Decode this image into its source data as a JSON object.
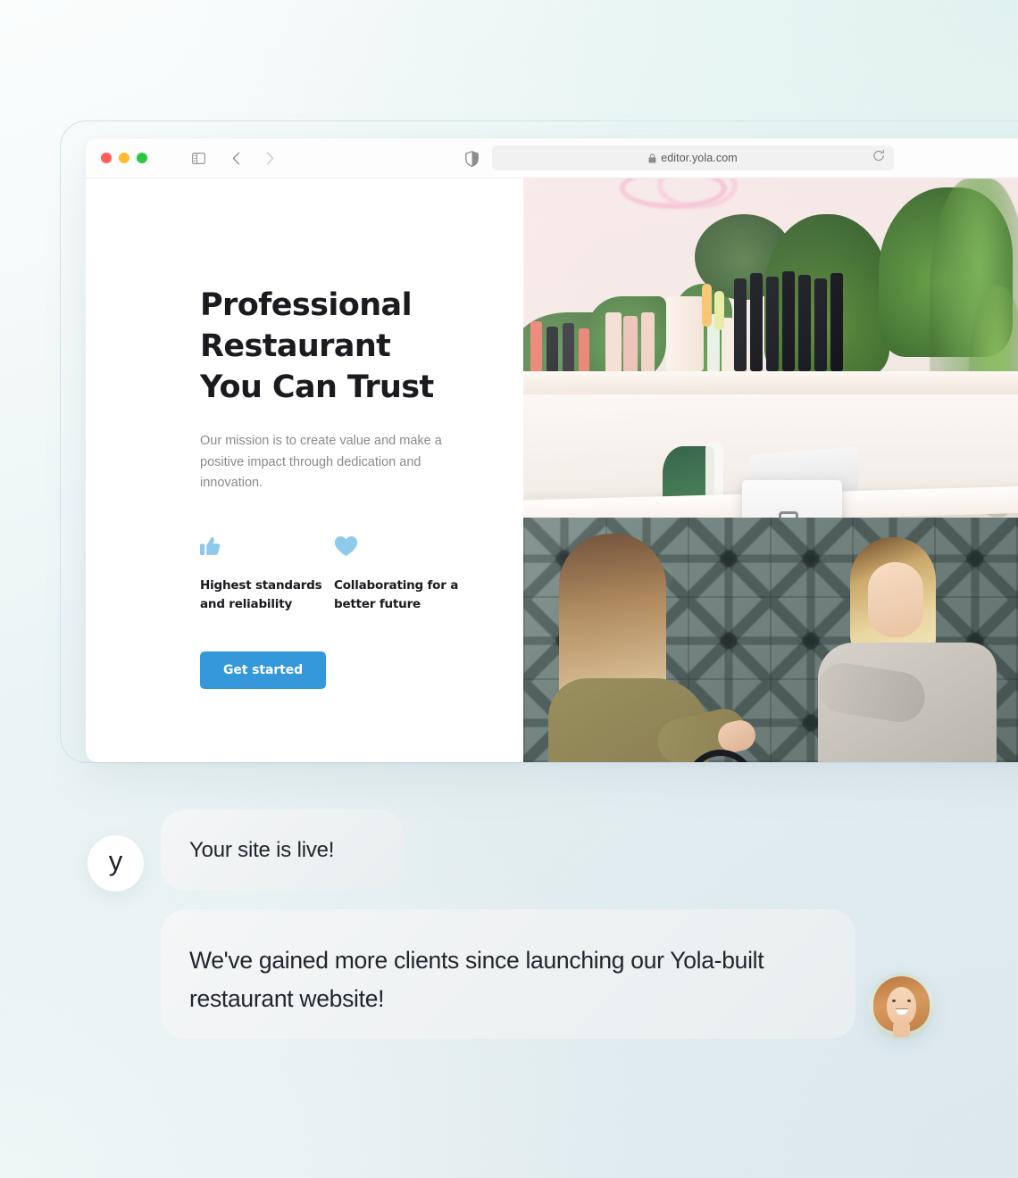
{
  "browser": {
    "traffic_lights": [
      "close",
      "minimize",
      "maximize"
    ],
    "sidebar_icon": "sidebar-toggle-icon",
    "back_icon": "chevron-left-icon",
    "forward_icon": "chevron-right-icon",
    "shield_icon": "shield-icon",
    "lock_icon": "lock-icon",
    "url": "editor.yola.com",
    "reload_icon": "reload-icon"
  },
  "hero": {
    "headline": "Professional Restaurant You Can Trust",
    "subtext": "Our mission is to create value and make a positive impact through dedication and innovation.",
    "features": [
      {
        "icon": "thumbs-up-icon",
        "label": "Highest standards and reliability"
      },
      {
        "icon": "heart-icon",
        "label": "Collaborating for a better future"
      }
    ],
    "cta_label": "Get started",
    "photo_alt": "Two women at a salon reception counter with plants"
  },
  "chat": {
    "brand_logo": "y",
    "messages": [
      {
        "author": "yola",
        "text": "Your site is live!"
      },
      {
        "author": "customer",
        "text": "We've gained more clients since launching our Yola-built restaurant website!"
      }
    ],
    "customer_avatar": "smiling-woman-portrait"
  },
  "colors": {
    "accent_blue": "#3498db",
    "feature_icon_blue": "#8fc9ec",
    "heading": "#1a1a1f",
    "body_text": "#8a8a8f",
    "bubble_bg": "#eef1f2",
    "page_bg_start": "#fbfdfd",
    "page_bg_end": "#e4edf1",
    "frame_border": "#cfe4ec"
  }
}
